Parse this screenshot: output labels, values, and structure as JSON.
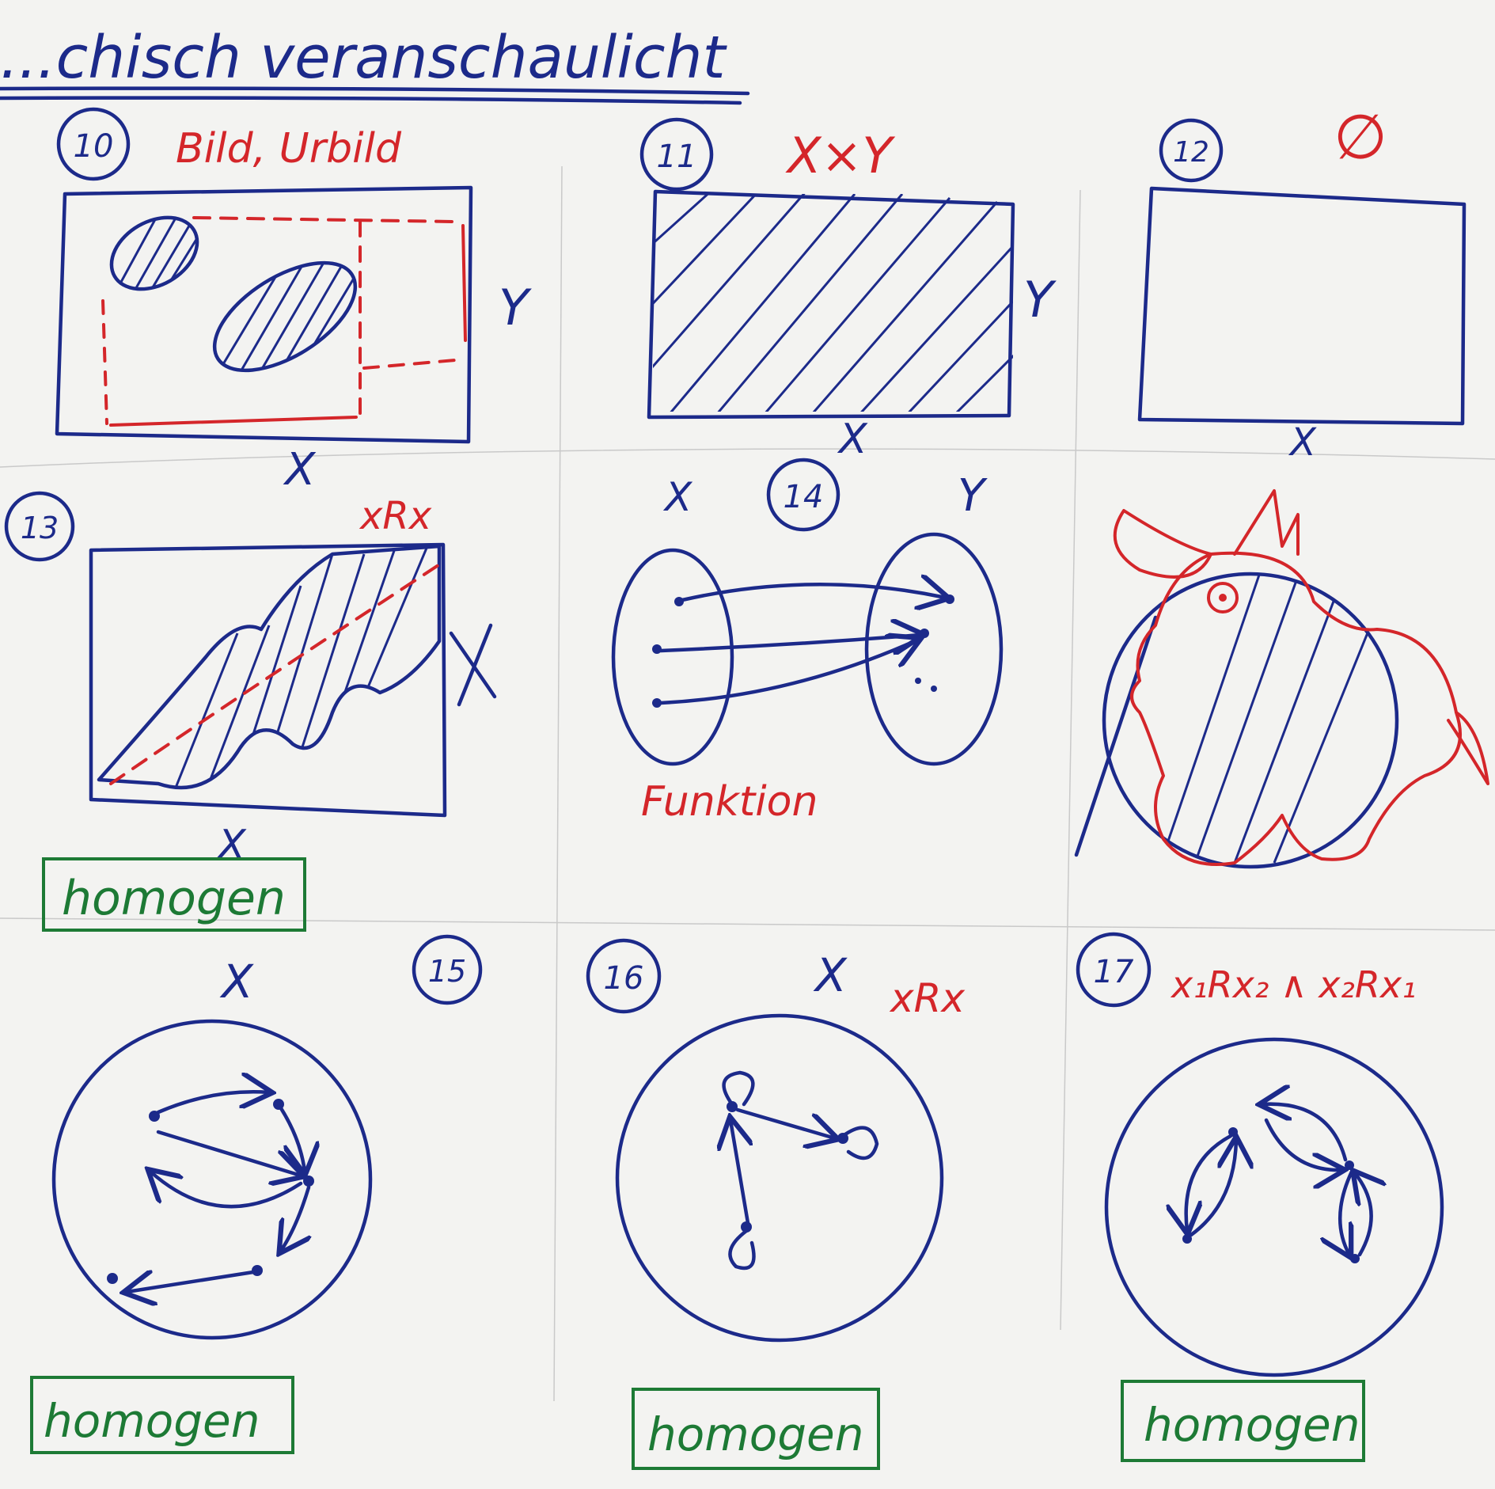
{
  "heading": "...chisch veranschaulicht",
  "cells": [
    {
      "number": "10",
      "caption": "Bild, Urbild",
      "x_label": "X",
      "y_label": "Y"
    },
    {
      "number": "11",
      "caption": "X×Y",
      "x_label": "X",
      "y_label": "Y"
    },
    {
      "number": "12",
      "caption": "∅",
      "x_label": "X"
    },
    {
      "number": "13",
      "caption": "xRx",
      "x_label": "X",
      "badge": "homogen"
    },
    {
      "number": "14",
      "caption": "Funktion",
      "x_label": "X",
      "y_label": "Y"
    },
    {
      "number": "15",
      "x_label": "X",
      "badge": "homogen"
    },
    {
      "number": "16",
      "x_label": "X",
      "caption": "xRx",
      "badge": "homogen"
    },
    {
      "number": "17",
      "caption": "x₁Rx₂ ∧ x₂Rx₁",
      "badge": "homogen"
    }
  ],
  "colors": {
    "ink_blue": "#1c2a8a",
    "ink_red": "#d4262a",
    "ink_green": "#1d7a35",
    "paper": "#f3f3f1"
  }
}
